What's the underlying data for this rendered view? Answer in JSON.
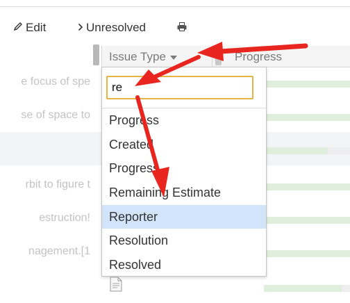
{
  "toolbar": {
    "edit_label": "Edit",
    "unresolved_label": "Unresolved",
    "edit_icon": "pencil-icon",
    "unresolved_icon": "chevron-right-icon",
    "print_icon": "printer-icon"
  },
  "columns": {
    "issue_type": "Issue Type",
    "progress": "Progress"
  },
  "background_rows": [
    "e focus of spe",
    "se of space to",
    "",
    "rbit to figure t",
    "estruction!",
    "nagement.[1"
  ],
  "dropdown": {
    "search_value": "re",
    "options": [
      "Progress",
      "Created",
      "Progress",
      "Remaining Estimate",
      "Reporter",
      "Resolution",
      "Resolved"
    ],
    "selected": "Reporter"
  },
  "colors": {
    "selected_option": "#d2e4fa",
    "search_border": "#e6b445",
    "annotation_arrow": "#e8251f",
    "progress_bar": "#e0eedc"
  }
}
